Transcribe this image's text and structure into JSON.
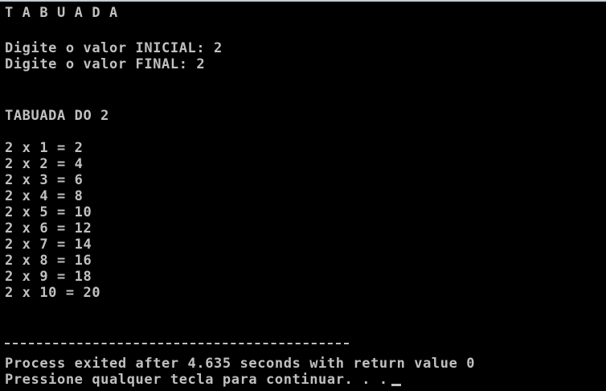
{
  "console": {
    "title_line": "T A B U A D A",
    "prompt_initial": "Digite o valor INICIAL: 2",
    "prompt_final": "Digite o valor FINAL: 2",
    "table_header": "TABUADA DO 2",
    "rows": [
      "2 x 1 = 2",
      "2 x 2 = 4",
      "2 x 3 = 6",
      "2 x 4 = 8",
      "2 x 5 = 10",
      "2 x 6 = 12",
      "2 x 7 = 14",
      "2 x 8 = 16",
      "2 x 9 = 18",
      "2 x 10 = 20"
    ],
    "separator": "--------------------------------",
    "process_exit": "Process exited after 4.635 seconds with return value 0",
    "continue_prompt": "Pressione qualquer tecla para continuar. . ."
  },
  "colors": {
    "background": "#000000",
    "text": "#c0c0c0"
  }
}
